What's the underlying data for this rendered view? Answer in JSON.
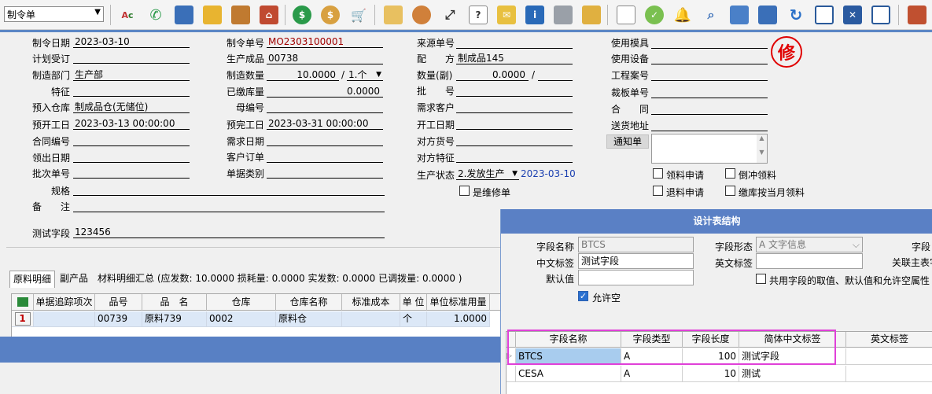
{
  "toolbar": {
    "doc_type": "制令单",
    "icons": [
      "abc-spell-icon",
      "phone-icon",
      "computer-icon",
      "lock-icon",
      "briefcase-icon",
      "home-icon",
      "dollar-icon",
      "money-bag-icon",
      "cart-icon",
      "clipboard-icon",
      "users-icon",
      "share-icon",
      "help-icon",
      "mail-icon",
      "info-icon",
      "calculator-icon",
      "folder-icon",
      "document-icon",
      "check-icon",
      "bell-icon",
      "search-icon",
      "org-tree-icon",
      "monitor-icon",
      "refresh-icon",
      "window-icon",
      "close-icon",
      "restore-icon",
      "exit-icon"
    ]
  },
  "form": {
    "col1": {
      "order_date_label": "制令日期",
      "order_date": "2023-03-10",
      "plan_label": "计划受订",
      "dept_label": "制造部门",
      "dept": "生产部",
      "feature_label": "特征",
      "warehouse_label": "预入仓库",
      "warehouse": "制成品仓(无储位)",
      "start_label": "预开工日",
      "start": "2023-03-13 00:00:00",
      "contract_label": "合同编号",
      "pick_label": "领出日期",
      "batch_label": "批次单号",
      "spec_label": "规格",
      "remark_label": "备　　注",
      "test_label": "测试字段",
      "test": "123456"
    },
    "col2": {
      "order_no_label": "制令单号",
      "order_no": "MO2303100001",
      "product_label": "生产成品",
      "product": "00738",
      "qty_label": "制造数量",
      "qty": "10.0000",
      "unit": "1.个",
      "paid_label": "已缴库量",
      "paid": "0.0000",
      "parent_label": "母编号",
      "finish_label": "预完工日",
      "finish": "2023-03-31 00:00:00",
      "demand_label": "需求日期",
      "customer_order_label": "客户订单",
      "type_label": "单据类别"
    },
    "col3": {
      "source_label": "来源单号",
      "recipe_label": "配　　方",
      "recipe": "制成品145",
      "qty2_label": "数量(副)",
      "qty2": "0.0000",
      "batch_label": "批　　号",
      "customer_label": "需求客户",
      "open_label": "开工日期",
      "their_code_label": "对方货号",
      "their_feature_label": "对方特征",
      "status_label": "生产状态",
      "status": "2.发放生产",
      "status_date": "2023-03-10",
      "repair_label": "是维修单"
    },
    "col4": {
      "mold_label": "使用模具",
      "device_label": "使用设备",
      "project_label": "工程案号",
      "cut_label": "裁板单号",
      "contract_label": "合　　同",
      "delivery_label": "送货地址",
      "notice_label": "通知单",
      "cb_apply": "领料申请",
      "cb_reverse": "倒冲领料",
      "cb_return": "退料申请",
      "cb_month": "缴库按当月领料"
    },
    "seal_text": "修"
  },
  "tabs": {
    "tab1": "原料明细",
    "tab2": "副产品",
    "summary": "材料明细汇总 (应发数: 10.0000 损耗量: 0.0000 实发数: 0.0000 已调拨量: 0.0000 )"
  },
  "grid": {
    "headers": [
      "单据追踪项次",
      "品号",
      "品　名",
      "仓库",
      "仓库名称",
      "标准成本",
      "单 位",
      "单位标准用量"
    ],
    "row": [
      "1",
      "00739",
      "原料739",
      "0002",
      "原料仓",
      "",
      "个",
      "1.0000"
    ]
  },
  "dialog": {
    "title": "设计表结构",
    "field_name_label": "字段名称",
    "field_name": "BTCS",
    "form_label": "字段形态",
    "form_value": "A 文字信息",
    "cut_label": "字段",
    "cn_label": "中文标签",
    "cn_value": "测试字段",
    "en_label": "英文标签",
    "related_label": "关联主表字",
    "default_label": "默认值",
    "share_label": "共用字段的取值、默认值和允许空属性",
    "allow_null_label": "允许空",
    "headers": [
      "字段名称",
      "字段类型",
      "字段长度",
      "简体中文标签",
      "英文标签"
    ],
    "rows": [
      [
        "BTCS",
        "A",
        "100",
        "测试字段",
        ""
      ],
      [
        "CESA",
        "A",
        "10",
        "测试",
        ""
      ]
    ]
  }
}
